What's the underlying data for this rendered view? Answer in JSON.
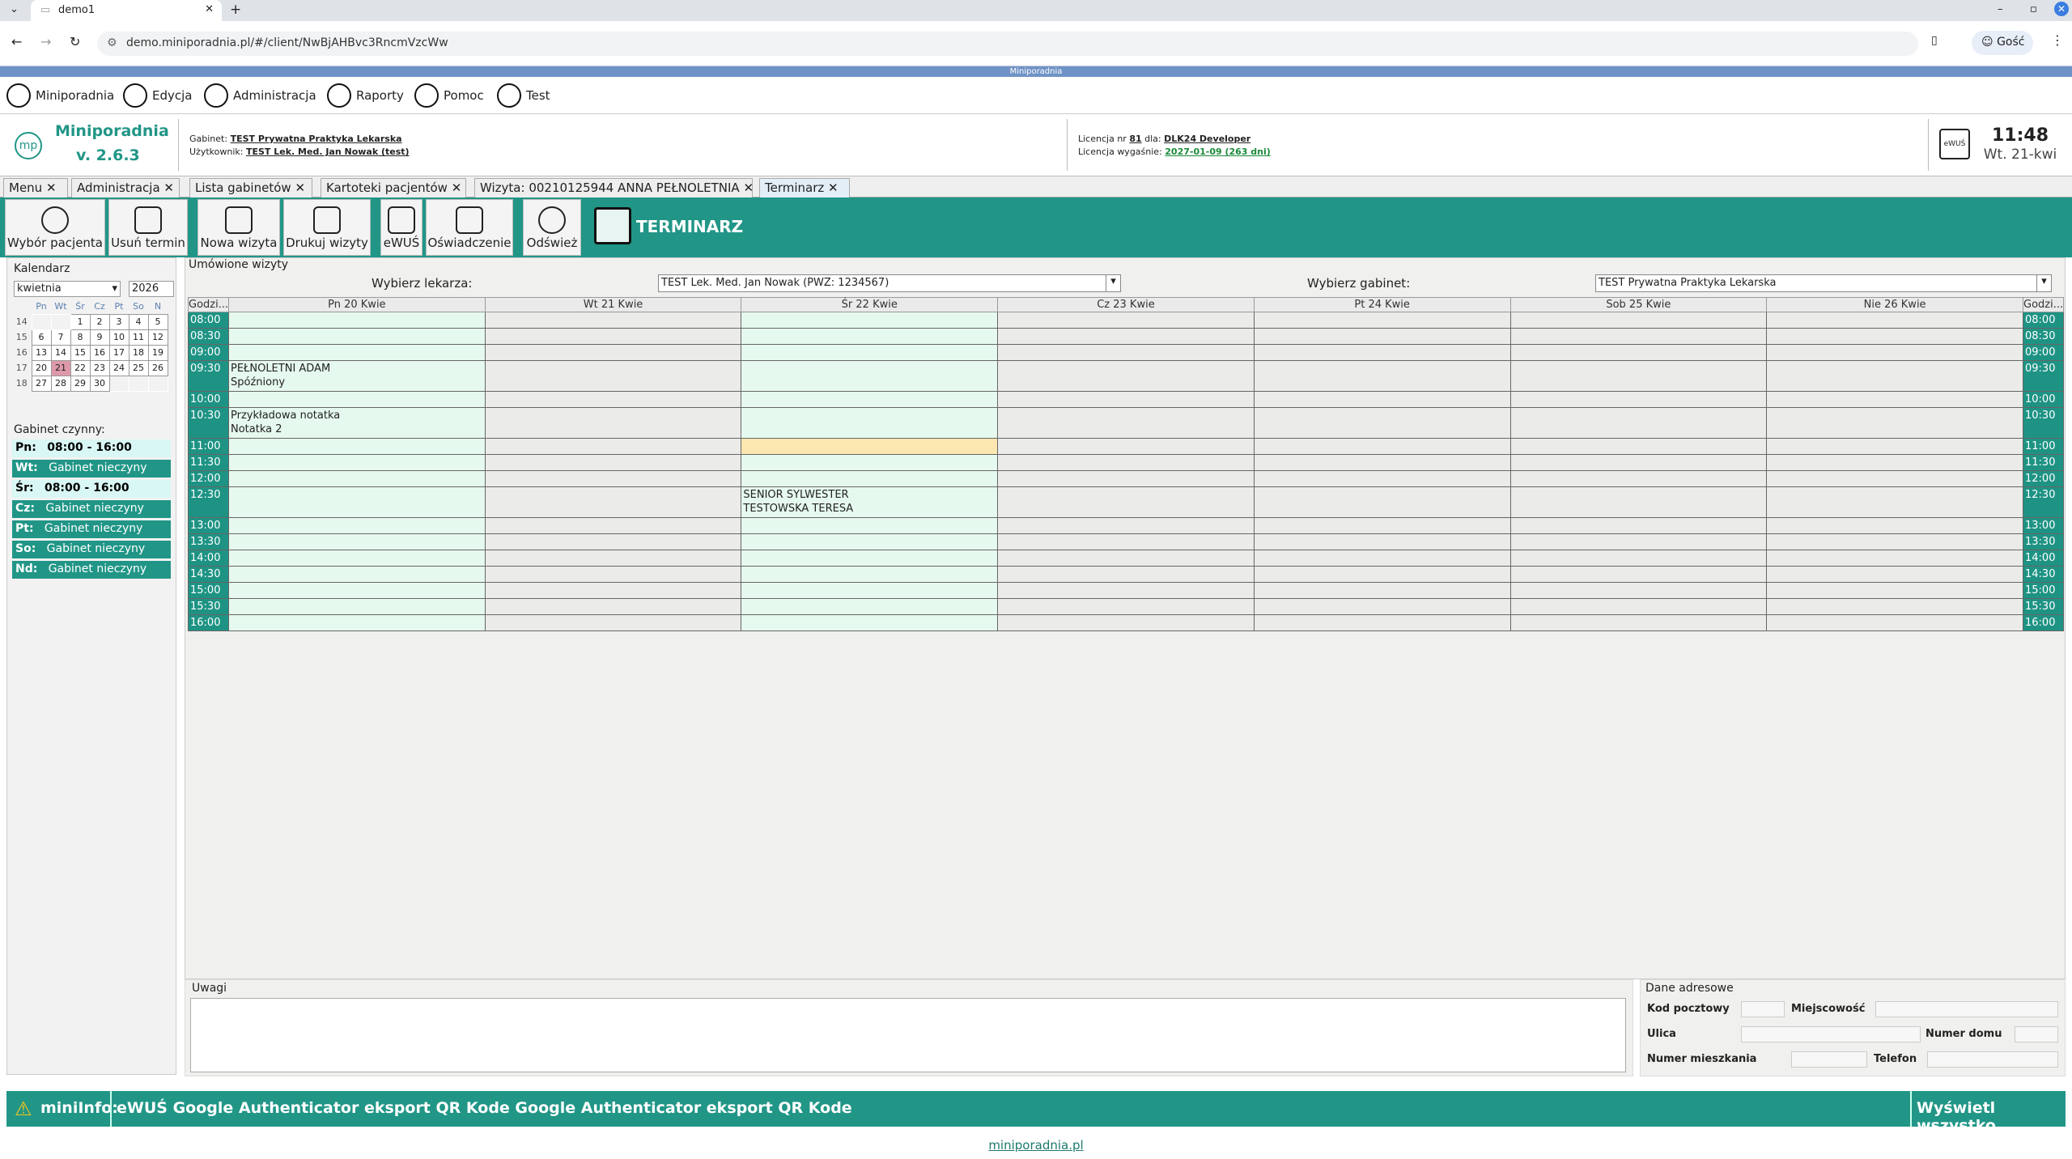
{
  "browser": {
    "tab_title": "demo1",
    "url": "demo.miniporadnia.pl/#/client/NwBjAHBvc3RncmVzcWw",
    "profile": "Gość"
  },
  "app_title": "Miniporadnia",
  "menu": [
    "Miniporadnia",
    "Edycja",
    "Administracja",
    "Raporty",
    "Pomoc",
    "Test"
  ],
  "header": {
    "app_name": "Miniporadnia",
    "version": "v. 2.6.3",
    "gabinet_label": "Gabinet:",
    "gabinet": "TEST Prywatna Praktyka Lekarska",
    "user_label": "Użytkownik:",
    "user": "TEST Lek. Med. Jan Nowak (test)",
    "license_pre": "Licencja nr",
    "license_no": "81",
    "license_mid": "dla:",
    "license_owner": "DLK24 Developer",
    "expire_label": "Licencja wygaśnie:",
    "expire": "2027-01-09 (263 dni)",
    "time": "11:48",
    "date": "Wt. 21-kwi",
    "logo": "mp"
  },
  "tabs": [
    "Menu",
    "Administracja",
    "Lista gabinetów",
    "Kartoteki pacjentów",
    "Wizyta: 00210125944 ANNA PEŁNOLETNIA",
    "Terminarz"
  ],
  "toolbar": {
    "buttons": [
      "Wybór pacjenta",
      "Usuń termin",
      "Nowa wizyta",
      "Drukuj wizyty",
      "eWUŚ",
      "Oświadczenie",
      "Odśwież"
    ],
    "title": "TERMINARZ"
  },
  "left": {
    "cal_title": "Kalendarz",
    "month": "kwietnia",
    "year": "2026",
    "day_headers": [
      "Pn",
      "Wt",
      "Śr",
      "Cz",
      "Pt",
      "So",
      "N"
    ],
    "weeks": [
      [
        "14",
        "",
        "",
        "1",
        "2",
        "3",
        "4",
        "5"
      ],
      [
        "15",
        "6",
        "7",
        "8",
        "9",
        "10",
        "11",
        "12"
      ],
      [
        "16",
        "13",
        "14",
        "15",
        "16",
        "17",
        "18",
        "19"
      ],
      [
        "17",
        "20",
        "21",
        "22",
        "23",
        "24",
        "25",
        "26"
      ],
      [
        "18",
        "27",
        "28",
        "29",
        "30",
        "",
        "",
        ""
      ]
    ],
    "hours_title": "Gabinet czynny:",
    "hours": [
      {
        "day": "Pn:",
        "val": "08:00 - 16:00",
        "open": true
      },
      {
        "day": "Wt:",
        "val": "Gabinet nieczyny",
        "open": false
      },
      {
        "day": "Śr:",
        "val": "08:00 - 16:00",
        "open": true
      },
      {
        "day": "Cz:",
        "val": "Gabinet nieczyny",
        "open": false
      },
      {
        "day": "Pt:",
        "val": "Gabinet nieczyny",
        "open": false
      },
      {
        "day": "So:",
        "val": "Gabinet nieczyny",
        "open": false
      },
      {
        "day": "Nd:",
        "val": "Gabinet nieczyny",
        "open": false
      }
    ]
  },
  "schedule": {
    "section_title": "Umówione wizyty",
    "doctor_label": "Wybierz lekarza:",
    "doctor": "TEST Lek. Med. Jan Nowak (PWZ: 1234567)",
    "office_label": "Wybierz gabinet:",
    "office": "TEST Prywatna Praktyka Lekarska",
    "time_header": "Godzi...",
    "days": [
      "Pn 20 Kwie",
      "Wt 21 Kwie",
      "Śr 22 Kwie",
      "Cz 23 Kwie",
      "Pt 24 Kwie",
      "Sob 25 Kwie",
      "Nie 26 Kwie"
    ],
    "rows": [
      {
        "t": "08:00",
        "c": [
          "",
          "",
          "",
          "",
          "",
          "",
          ""
        ]
      },
      {
        "t": "08:30",
        "c": [
          "",
          "",
          "",
          "",
          "",
          "",
          ""
        ]
      },
      {
        "t": "09:00",
        "c": [
          "",
          "",
          "",
          "",
          "",
          "",
          ""
        ]
      },
      {
        "t": "09:30",
        "c": [
          "PEŁNOLETNI ADAM\nSpóźniony",
          "",
          "",
          "",
          "",
          "",
          ""
        ]
      },
      {
        "t": "10:00",
        "c": [
          "",
          "",
          "",
          "",
          "",
          "",
          ""
        ]
      },
      {
        "t": "10:30",
        "c": [
          "Przykładowa notatka\nNotatka 2",
          "",
          "",
          "",
          "",
          "",
          ""
        ]
      },
      {
        "t": "11:00",
        "c": [
          "",
          "",
          "",
          "",
          "",
          "",
          ""
        ]
      },
      {
        "t": "11:30",
        "c": [
          "",
          "",
          "",
          "",
          "",
          "",
          ""
        ]
      },
      {
        "t": "12:00",
        "c": [
          "",
          "",
          "",
          "",
          "",
          "",
          ""
        ]
      },
      {
        "t": "12:30",
        "c": [
          "",
          "",
          "SENIOR SYLWESTER\nTESTOWSKA TERESA",
          "",
          "",
          "",
          ""
        ]
      },
      {
        "t": "13:00",
        "c": [
          "",
          "",
          "",
          "",
          "",
          "",
          ""
        ]
      },
      {
        "t": "13:30",
        "c": [
          "",
          "",
          "",
          "",
          "",
          "",
          ""
        ]
      },
      {
        "t": "14:00",
        "c": [
          "",
          "",
          "",
          "",
          "",
          "",
          ""
        ]
      },
      {
        "t": "14:30",
        "c": [
          "",
          "",
          "",
          "",
          "",
          "",
          ""
        ]
      },
      {
        "t": "15:00",
        "c": [
          "",
          "",
          "",
          "",
          "",
          "",
          ""
        ]
      },
      {
        "t": "15:30",
        "c": [
          "",
          "",
          "",
          "",
          "",
          "",
          ""
        ]
      },
      {
        "t": "16:00",
        "c": [
          "",
          "",
          "",
          "",
          "",
          "",
          ""
        ]
      }
    ]
  },
  "notes": {
    "title": "Uwagi"
  },
  "address": {
    "title": "Dane adresowe",
    "kod": "Kod pocztowy",
    "miejscowosc": "Miejscowość",
    "ulica": "Ulica",
    "nr_domu": "Numer domu",
    "nr_mieszkania": "Numer mieszkania",
    "telefon": "Telefon"
  },
  "info": {
    "label": "miniInfo:",
    "text": "eWUŚ Google Authenticator eksport QR Kode Google Authenticator eksport QR Kode",
    "show_all": "Wyświetl wszystko"
  },
  "footer": "miniporadnia.pl"
}
